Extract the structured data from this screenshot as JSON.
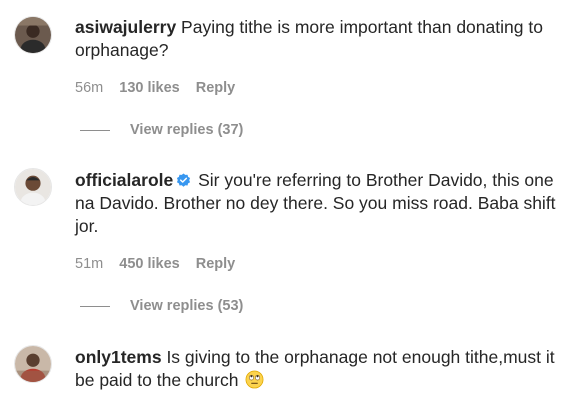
{
  "comments": [
    {
      "username": "asiwajulerry",
      "verified": false,
      "text": "Paying tithe is more important than donating to orphanage?",
      "time": "56m",
      "likes": "130 likes",
      "reply_label": "Reply",
      "view_replies": "View replies (37)"
    },
    {
      "username": "officialarole",
      "verified": true,
      "text": "Sir you're referring to Brother Davido, this one na Davido. Brother no dey there. So you miss road. Baba shift jor.",
      "time": "51m",
      "likes": "450 likes",
      "reply_label": "Reply",
      "view_replies": "View replies (53)"
    },
    {
      "username": "only1tems",
      "verified": false,
      "text": "Is giving to the orphanage not enough tithe,must it be paid to the church",
      "emoji": "face-with-rolling-eyes-emoji"
    }
  ],
  "colors": {
    "text": "#262626",
    "muted": "#8e8e8e",
    "verified": "#3897f0"
  }
}
